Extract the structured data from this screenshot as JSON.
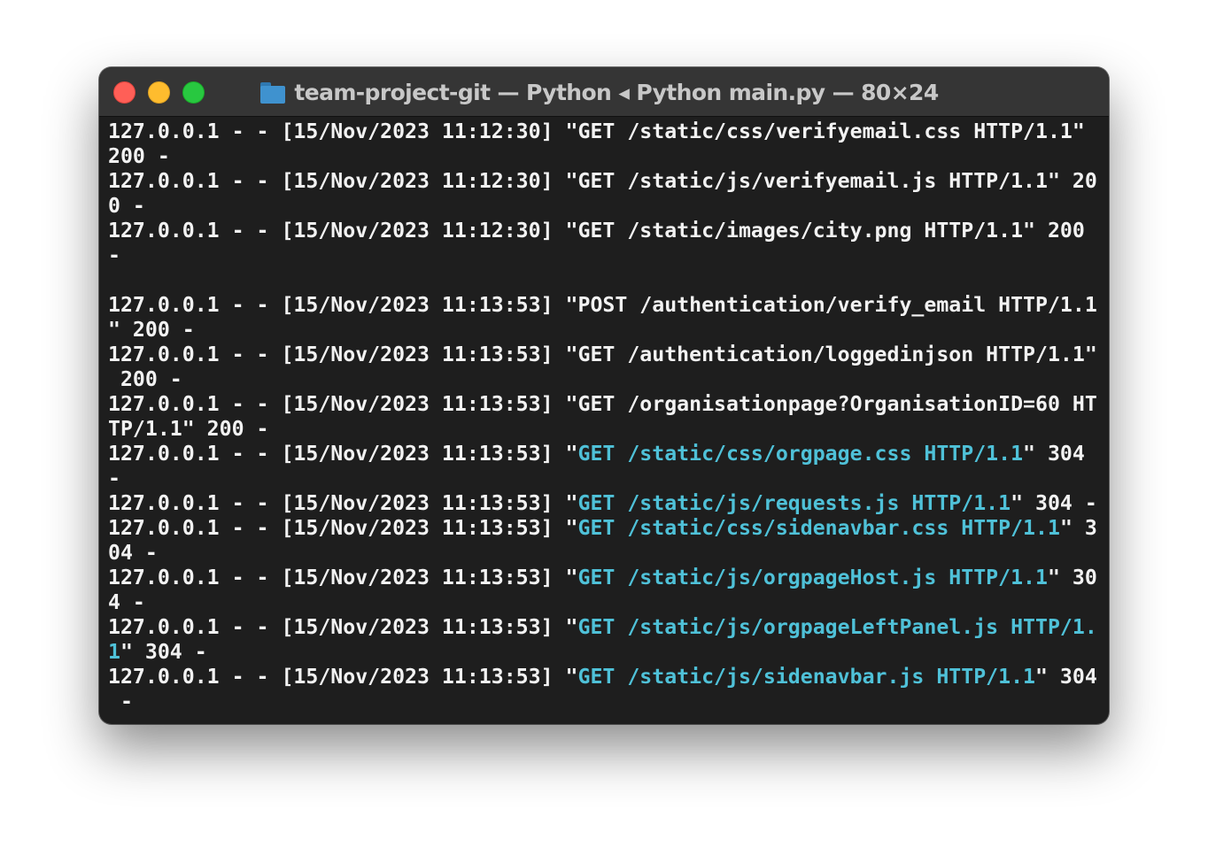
{
  "window": {
    "title": "team-project-git — Python ◂ Python main.py — 80×24",
    "folder_icon": "folder-icon",
    "traffic_lights": [
      "close",
      "minimize",
      "zoom"
    ],
    "highlight_color": "#4fc1d8",
    "text_color": "#f2f2f2",
    "background": "#1e1e1e"
  },
  "terminal": {
    "lines": [
      {
        "pre": "127.0.0.1 - - [15/Nov/2023 11:12:30] \"GET /static/css/verifyemail.css HTTP/1.1\"",
        "hl": "",
        "post": ""
      },
      {
        "pre": "200 -",
        "hl": "",
        "post": ""
      },
      {
        "pre": "127.0.0.1 - - [15/Nov/2023 11:12:30] \"GET /static/js/verifyemail.js HTTP/1.1\" 20",
        "hl": "",
        "post": ""
      },
      {
        "pre": "0 -",
        "hl": "",
        "post": ""
      },
      {
        "pre": "127.0.0.1 - - [15/Nov/2023 11:12:30] \"GET /static/images/city.png HTTP/1.1\" 200",
        "hl": "",
        "post": ""
      },
      {
        "pre": "-",
        "hl": "",
        "post": ""
      },
      {
        "pre": "",
        "hl": "",
        "post": ""
      },
      {
        "pre": "127.0.0.1 - - [15/Nov/2023 11:13:53] \"POST /authentication/verify_email HTTP/1.1",
        "hl": "",
        "post": ""
      },
      {
        "pre": "\" 200 -",
        "hl": "",
        "post": ""
      },
      {
        "pre": "127.0.0.1 - - [15/Nov/2023 11:13:53] \"GET /authentication/loggedinjson HTTP/1.1\"",
        "hl": "",
        "post": ""
      },
      {
        "pre": " 200 -",
        "hl": "",
        "post": ""
      },
      {
        "pre": "127.0.0.1 - - [15/Nov/2023 11:13:53] \"GET /organisationpage?OrganisationID=60 HT",
        "hl": "",
        "post": ""
      },
      {
        "pre": "TP/1.1\" 200 -",
        "hl": "",
        "post": ""
      },
      {
        "pre": "127.0.0.1 - - [15/Nov/2023 11:13:53] \"",
        "hl": "GET /static/css/orgpage.css HTTP/1.1",
        "post": "\" 304"
      },
      {
        "pre": "-",
        "hl": "",
        "post": ""
      },
      {
        "pre": "127.0.0.1 - - [15/Nov/2023 11:13:53] \"",
        "hl": "GET /static/js/requests.js HTTP/1.1",
        "post": "\" 304 -"
      },
      {
        "pre": "127.0.0.1 - - [15/Nov/2023 11:13:53] \"",
        "hl": "GET /static/css/sidenavbar.css HTTP/1.1",
        "post": "\" 3"
      },
      {
        "pre": "04 -",
        "hl": "",
        "post": ""
      },
      {
        "pre": "127.0.0.1 - - [15/Nov/2023 11:13:53] \"",
        "hl": "GET /static/js/orgpageHost.js HTTP/1.1",
        "post": "\" 30"
      },
      {
        "pre": "4 -",
        "hl": "",
        "post": ""
      },
      {
        "pre": "127.0.0.1 - - [15/Nov/2023 11:13:53] \"",
        "hl": "GET /static/js/orgpageLeftPanel.js HTTP/1.",
        "post": ""
      },
      {
        "pre": "",
        "hl": "1",
        "post": "\" 304 -"
      },
      {
        "pre": "127.0.0.1 - - [15/Nov/2023 11:13:53] \"",
        "hl": "GET /static/js/sidenavbar.js HTTP/1.1",
        "post": "\" 304"
      },
      {
        "pre": " -",
        "hl": "",
        "post": ""
      }
    ]
  }
}
